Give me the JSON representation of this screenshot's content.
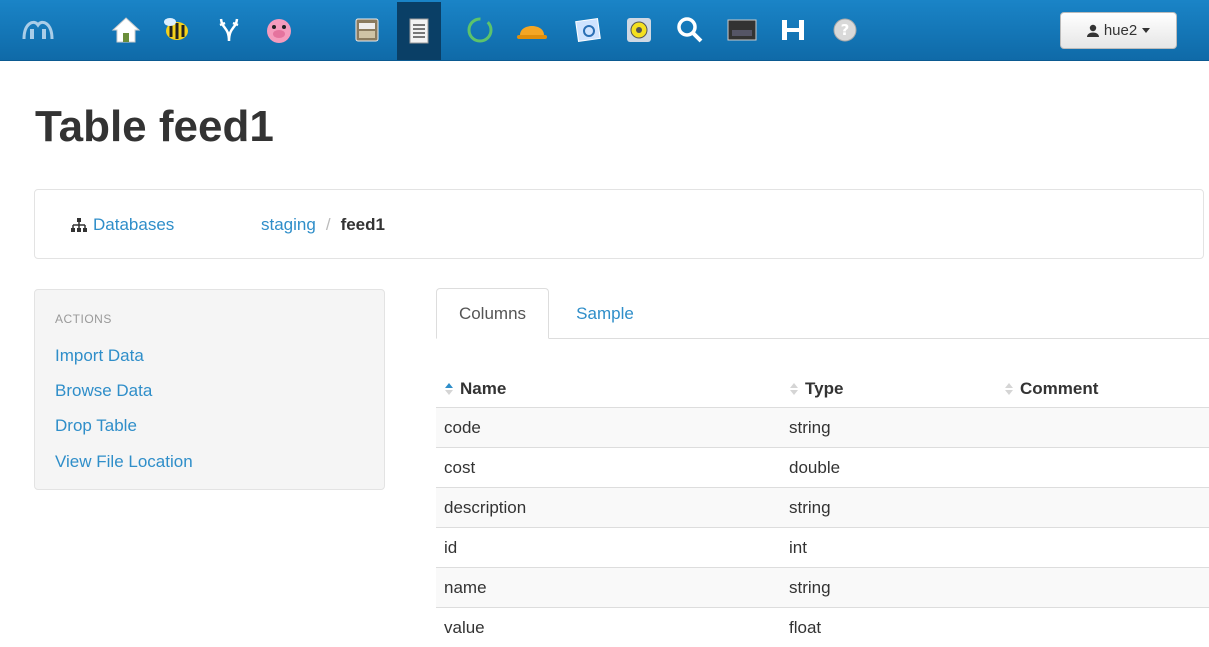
{
  "navbar": {
    "icons": [
      "hue-logo-icon",
      "home-icon",
      "bee-icon",
      "hive-icon",
      "pig-icon",
      "file-browser-icon",
      "metastore-icon",
      "oozie-icon",
      "hard-hat-icon",
      "picture-icon",
      "sqoop-icon",
      "search-icon",
      "shell-icon",
      "hbase-icon",
      "help-icon"
    ],
    "user": "hue2"
  },
  "page": {
    "title": "Table feed1"
  },
  "breadcrumb": {
    "databases": "Databases",
    "database": "staging",
    "separator": "/",
    "table": "feed1"
  },
  "actions": {
    "header": "ACTIONS",
    "items": [
      "Import Data",
      "Browse Data",
      "Drop Table",
      "View File Location"
    ]
  },
  "tabs": {
    "columns": "Columns",
    "sample": "Sample"
  },
  "columns_table": {
    "headers": {
      "name": "Name",
      "type": "Type",
      "comment": "Comment"
    },
    "rows": [
      {
        "name": "code",
        "type": "string",
        "comment": ""
      },
      {
        "name": "cost",
        "type": "double",
        "comment": ""
      },
      {
        "name": "description",
        "type": "string",
        "comment": ""
      },
      {
        "name": "id",
        "type": "int",
        "comment": ""
      },
      {
        "name": "name",
        "type": "string",
        "comment": ""
      },
      {
        "name": "value",
        "type": "float",
        "comment": ""
      }
    ]
  },
  "colors": {
    "link": "#2f8ec9",
    "navbar": "#1a84c7",
    "active_nav": "#0a3f66"
  }
}
